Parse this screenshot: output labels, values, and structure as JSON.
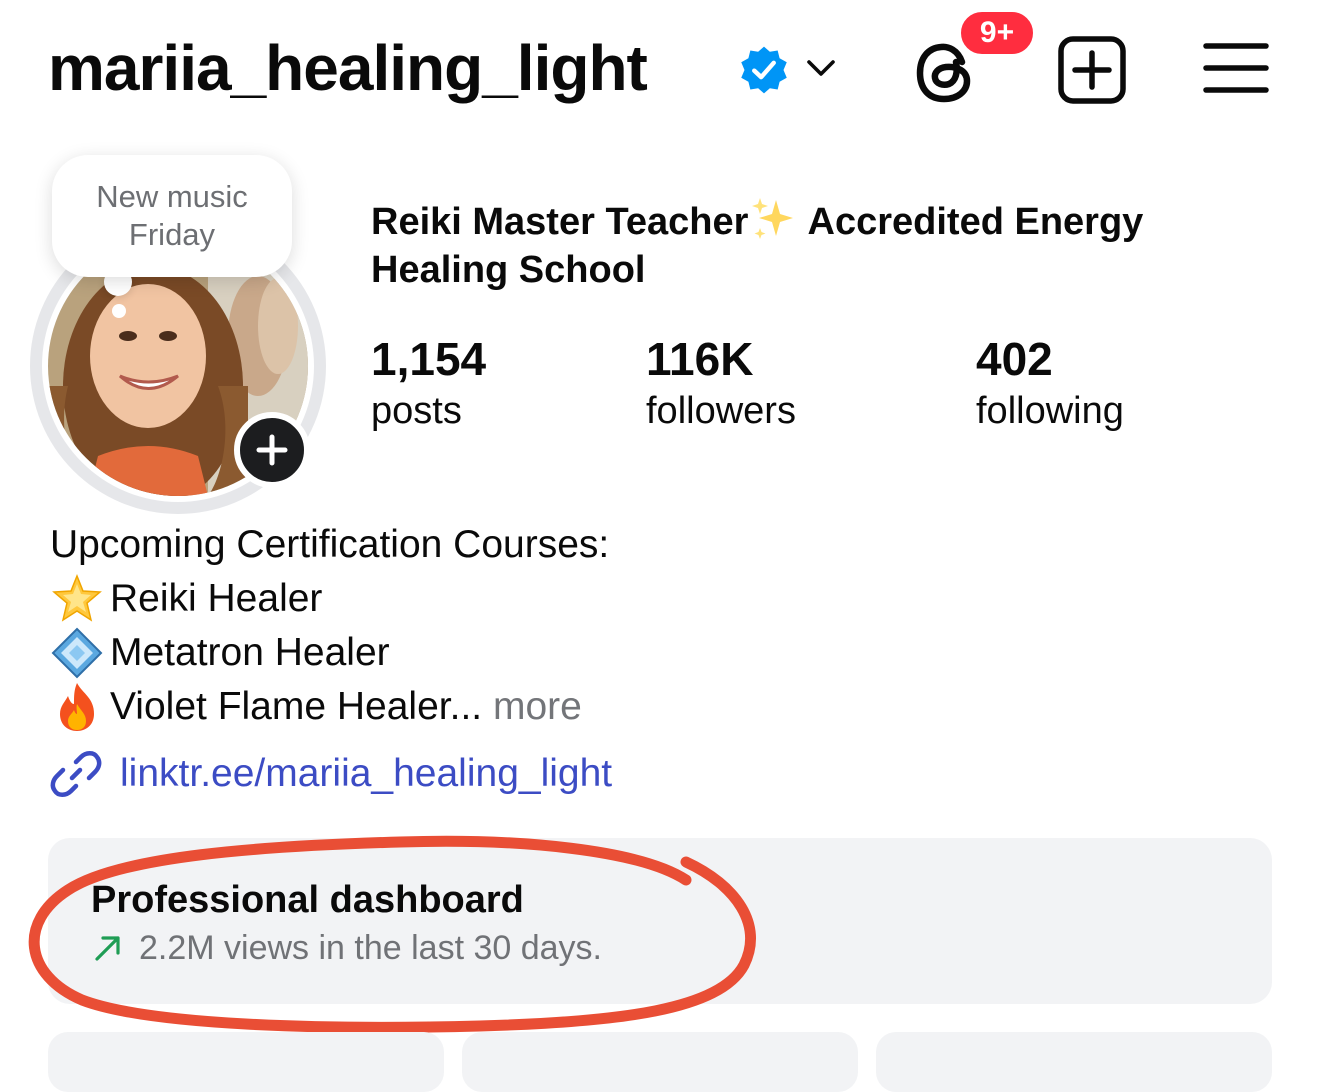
{
  "header": {
    "username": "mariia_healing_light",
    "verified_icon": "verified-badge-icon",
    "account_switch_icon": "chevron-down-icon",
    "threads_icon": "threads-icon",
    "threads_badge": "9+",
    "new_post_icon": "plus-square-icon",
    "menu_icon": "hamburger-menu-icon",
    "badge_color": "#ff2d3f",
    "verified_color": "#0095f6"
  },
  "note": {
    "line1": "New music",
    "line2": "Friday"
  },
  "profile": {
    "avatar": "profile-photo",
    "add_story_icon": "plus-icon",
    "title_part1": "Reiki Master Teacher",
    "title_emoji": "sparkles-emoji",
    "title_part2": " Accredited Energy Healing School",
    "stats": [
      {
        "value": "1,154",
        "label": "posts"
      },
      {
        "value": "116K",
        "label": "followers"
      },
      {
        "value": "402",
        "label": "following"
      }
    ]
  },
  "bio": {
    "heading": "Upcoming Certification Courses:",
    "items": [
      {
        "emoji": "glowing-star-emoji",
        "text": "Reiki Healer"
      },
      {
        "emoji": "diamond-shape-emoji",
        "text": "Metatron Healer"
      },
      {
        "emoji": "fire-emoji",
        "text": "Violet Flame Healer..."
      }
    ],
    "more": "more"
  },
  "link": {
    "icon": "link-icon",
    "text": "linktr.ee/mariia_healing_light",
    "color": "#3c4cc4"
  },
  "dashboard": {
    "title": "Professional dashboard",
    "trend_icon": "trend-up-arrow-icon",
    "subtitle": "2.2M views in the last 30 days.",
    "trend_color": "#1f9d55",
    "annotation_color": "#e8442a"
  }
}
